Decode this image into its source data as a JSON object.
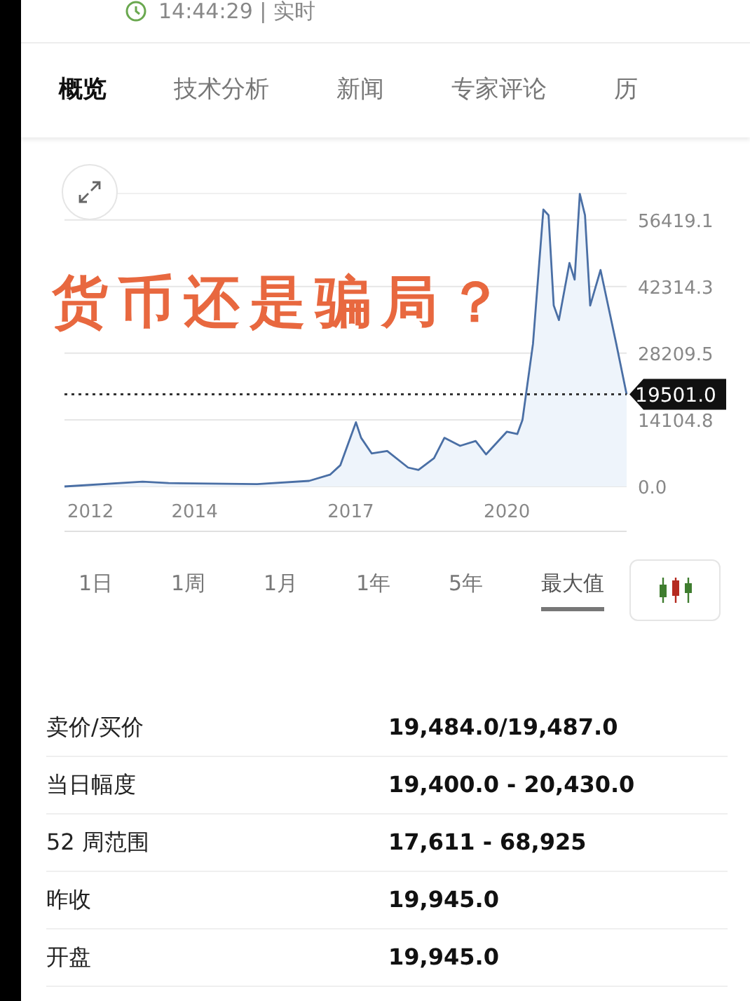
{
  "status": {
    "time": "14:44:29 | 实时"
  },
  "tabs": [
    {
      "label": "概览",
      "selected": true
    },
    {
      "label": "技术分析",
      "selected": false
    },
    {
      "label": "新闻",
      "selected": false
    },
    {
      "label": "专家评论",
      "selected": false
    },
    {
      "label": "历",
      "selected": false
    }
  ],
  "overlay_caption": "货币还是骗局？",
  "chart": {
    "chart_data": {
      "type": "line",
      "xlim": [
        2011.5,
        2022.3
      ],
      "ylim": [
        0,
        62000
      ],
      "grid": true,
      "xticks": [
        2012,
        2014,
        2017,
        2020
      ],
      "yticks": [
        {
          "value": 0,
          "label": "0.0"
        },
        {
          "value": 14104.8,
          "label": "14104.8"
        },
        {
          "value": 28209.5,
          "label": "28209.5"
        },
        {
          "value": 42314.3,
          "label": "42314.3"
        },
        {
          "value": 56419.1,
          "label": "56419.1"
        }
      ],
      "x": [
        2011.5,
        2013.0,
        2013.5,
        2015.2,
        2016.2,
        2016.6,
        2016.8,
        2017.1,
        2017.2,
        2017.4,
        2017.7,
        2018.1,
        2018.3,
        2018.6,
        2018.8,
        2019.1,
        2019.4,
        2019.6,
        2020.0,
        2020.2,
        2020.3,
        2020.5,
        2020.7,
        2020.8,
        2020.9,
        2021.0,
        2021.2,
        2021.3,
        2021.4,
        2021.5,
        2021.6,
        2021.8,
        2022.1,
        2022.3
      ],
      "series": [
        {
          "color": "#4a6fa5",
          "values": [
            0,
            1000,
            700,
            500,
            1200,
            2500,
            4500,
            13600,
            10300,
            7000,
            7500,
            4000,
            3500,
            6000,
            10300,
            8600,
            9600,
            6800,
            11600,
            11100,
            14100,
            30200,
            58600,
            57400,
            38300,
            35200,
            47300,
            43800,
            61900,
            57400,
            38300,
            45800,
            30200,
            19500
          ]
        }
      ],
      "ref_lines": [
        {
          "axis": "y",
          "value": 19501,
          "label": "19501.0"
        }
      ]
    }
  },
  "ranges": [
    {
      "label": "1日",
      "selected": false
    },
    {
      "label": "1周",
      "selected": false
    },
    {
      "label": "1月",
      "selected": false
    },
    {
      "label": "1年",
      "selected": false
    },
    {
      "label": "5年",
      "selected": false
    },
    {
      "label": "最大值",
      "selected": true
    }
  ],
  "stats": [
    {
      "label": "卖价/买价",
      "value": "19,484.0/19,487.0"
    },
    {
      "label": "当日幅度",
      "value": "19,400.0 - 20,430.0"
    },
    {
      "label": "52 周范围",
      "value": "17,611 - 68,925"
    },
    {
      "label": "昨收",
      "value": "19,945.0"
    },
    {
      "label": "开盘",
      "value": "19,945.0"
    }
  ]
}
